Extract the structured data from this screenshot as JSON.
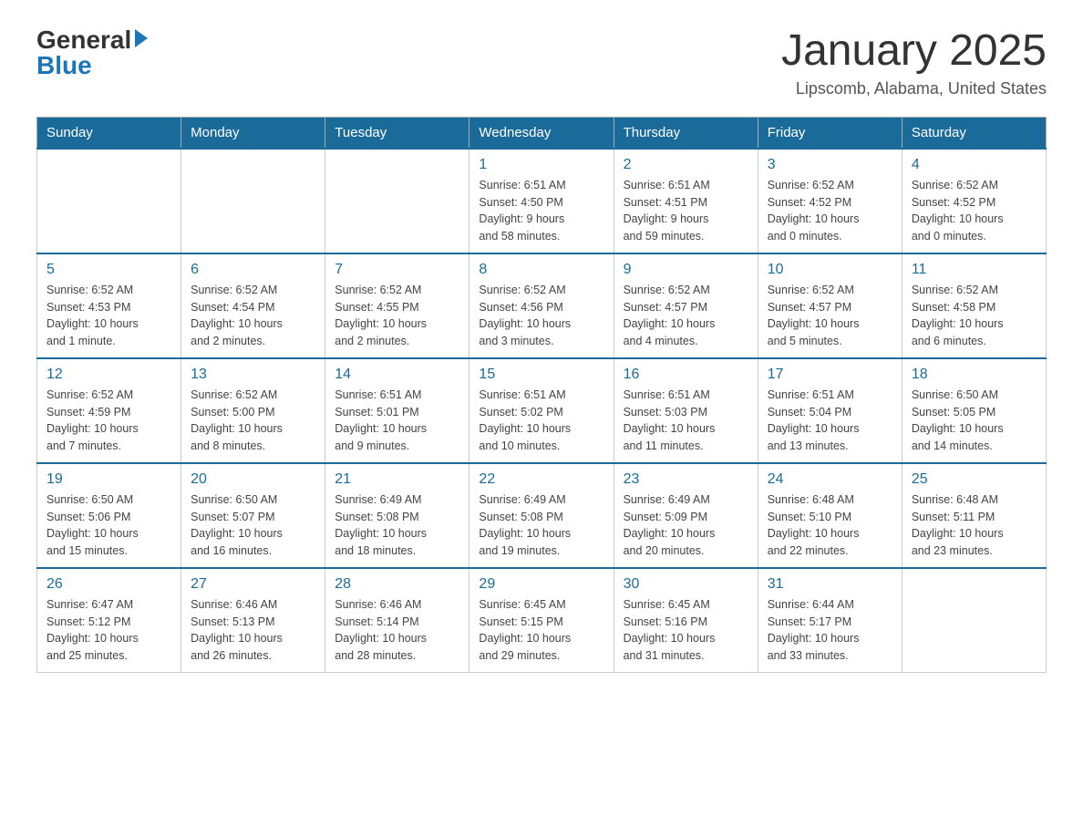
{
  "header": {
    "logo_general": "General",
    "logo_blue": "Blue",
    "month": "January 2025",
    "location": "Lipscomb, Alabama, United States"
  },
  "days_of_week": [
    "Sunday",
    "Monday",
    "Tuesday",
    "Wednesday",
    "Thursday",
    "Friday",
    "Saturday"
  ],
  "weeks": [
    [
      {
        "day": "",
        "info": ""
      },
      {
        "day": "",
        "info": ""
      },
      {
        "day": "",
        "info": ""
      },
      {
        "day": "1",
        "info": "Sunrise: 6:51 AM\nSunset: 4:50 PM\nDaylight: 9 hours\nand 58 minutes."
      },
      {
        "day": "2",
        "info": "Sunrise: 6:51 AM\nSunset: 4:51 PM\nDaylight: 9 hours\nand 59 minutes."
      },
      {
        "day": "3",
        "info": "Sunrise: 6:52 AM\nSunset: 4:52 PM\nDaylight: 10 hours\nand 0 minutes."
      },
      {
        "day": "4",
        "info": "Sunrise: 6:52 AM\nSunset: 4:52 PM\nDaylight: 10 hours\nand 0 minutes."
      }
    ],
    [
      {
        "day": "5",
        "info": "Sunrise: 6:52 AM\nSunset: 4:53 PM\nDaylight: 10 hours\nand 1 minute."
      },
      {
        "day": "6",
        "info": "Sunrise: 6:52 AM\nSunset: 4:54 PM\nDaylight: 10 hours\nand 2 minutes."
      },
      {
        "day": "7",
        "info": "Sunrise: 6:52 AM\nSunset: 4:55 PM\nDaylight: 10 hours\nand 2 minutes."
      },
      {
        "day": "8",
        "info": "Sunrise: 6:52 AM\nSunset: 4:56 PM\nDaylight: 10 hours\nand 3 minutes."
      },
      {
        "day": "9",
        "info": "Sunrise: 6:52 AM\nSunset: 4:57 PM\nDaylight: 10 hours\nand 4 minutes."
      },
      {
        "day": "10",
        "info": "Sunrise: 6:52 AM\nSunset: 4:57 PM\nDaylight: 10 hours\nand 5 minutes."
      },
      {
        "day": "11",
        "info": "Sunrise: 6:52 AM\nSunset: 4:58 PM\nDaylight: 10 hours\nand 6 minutes."
      }
    ],
    [
      {
        "day": "12",
        "info": "Sunrise: 6:52 AM\nSunset: 4:59 PM\nDaylight: 10 hours\nand 7 minutes."
      },
      {
        "day": "13",
        "info": "Sunrise: 6:52 AM\nSunset: 5:00 PM\nDaylight: 10 hours\nand 8 minutes."
      },
      {
        "day": "14",
        "info": "Sunrise: 6:51 AM\nSunset: 5:01 PM\nDaylight: 10 hours\nand 9 minutes."
      },
      {
        "day": "15",
        "info": "Sunrise: 6:51 AM\nSunset: 5:02 PM\nDaylight: 10 hours\nand 10 minutes."
      },
      {
        "day": "16",
        "info": "Sunrise: 6:51 AM\nSunset: 5:03 PM\nDaylight: 10 hours\nand 11 minutes."
      },
      {
        "day": "17",
        "info": "Sunrise: 6:51 AM\nSunset: 5:04 PM\nDaylight: 10 hours\nand 13 minutes."
      },
      {
        "day": "18",
        "info": "Sunrise: 6:50 AM\nSunset: 5:05 PM\nDaylight: 10 hours\nand 14 minutes."
      }
    ],
    [
      {
        "day": "19",
        "info": "Sunrise: 6:50 AM\nSunset: 5:06 PM\nDaylight: 10 hours\nand 15 minutes."
      },
      {
        "day": "20",
        "info": "Sunrise: 6:50 AM\nSunset: 5:07 PM\nDaylight: 10 hours\nand 16 minutes."
      },
      {
        "day": "21",
        "info": "Sunrise: 6:49 AM\nSunset: 5:08 PM\nDaylight: 10 hours\nand 18 minutes."
      },
      {
        "day": "22",
        "info": "Sunrise: 6:49 AM\nSunset: 5:08 PM\nDaylight: 10 hours\nand 19 minutes."
      },
      {
        "day": "23",
        "info": "Sunrise: 6:49 AM\nSunset: 5:09 PM\nDaylight: 10 hours\nand 20 minutes."
      },
      {
        "day": "24",
        "info": "Sunrise: 6:48 AM\nSunset: 5:10 PM\nDaylight: 10 hours\nand 22 minutes."
      },
      {
        "day": "25",
        "info": "Sunrise: 6:48 AM\nSunset: 5:11 PM\nDaylight: 10 hours\nand 23 minutes."
      }
    ],
    [
      {
        "day": "26",
        "info": "Sunrise: 6:47 AM\nSunset: 5:12 PM\nDaylight: 10 hours\nand 25 minutes."
      },
      {
        "day": "27",
        "info": "Sunrise: 6:46 AM\nSunset: 5:13 PM\nDaylight: 10 hours\nand 26 minutes."
      },
      {
        "day": "28",
        "info": "Sunrise: 6:46 AM\nSunset: 5:14 PM\nDaylight: 10 hours\nand 28 minutes."
      },
      {
        "day": "29",
        "info": "Sunrise: 6:45 AM\nSunset: 5:15 PM\nDaylight: 10 hours\nand 29 minutes."
      },
      {
        "day": "30",
        "info": "Sunrise: 6:45 AM\nSunset: 5:16 PM\nDaylight: 10 hours\nand 31 minutes."
      },
      {
        "day": "31",
        "info": "Sunrise: 6:44 AM\nSunset: 5:17 PM\nDaylight: 10 hours\nand 33 minutes."
      },
      {
        "day": "",
        "info": ""
      }
    ]
  ]
}
